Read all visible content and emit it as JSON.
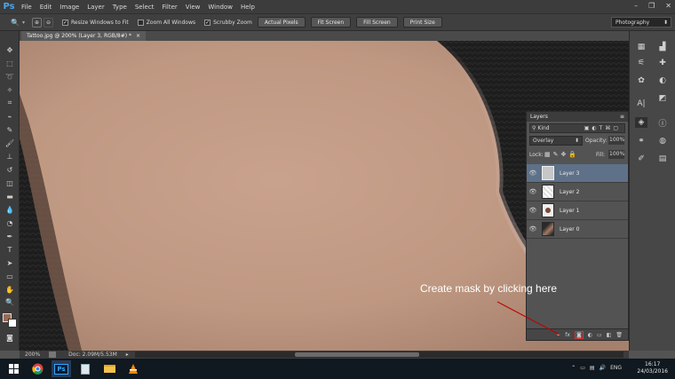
{
  "app": {
    "logo": "Ps"
  },
  "menu": [
    "File",
    "Edit",
    "Image",
    "Layer",
    "Type",
    "Select",
    "Filter",
    "View",
    "Window",
    "Help"
  ],
  "window_controls": [
    "–",
    "❐",
    "✕"
  ],
  "options": {
    "zoom_tool_icon": "🔍",
    "checks": [
      {
        "label": "Resize Windows to Fit",
        "checked": true
      },
      {
        "label": "Zoom All Windows",
        "checked": false
      },
      {
        "label": "Scrubby Zoom",
        "checked": true
      }
    ],
    "buttons": [
      "Actual Pixels",
      "Fit Screen",
      "Fill Screen",
      "Print Size"
    ],
    "workspace": "Photography"
  },
  "document_tab": "Tattoo.jpg @ 200% (Layer 3, RGB/8#) *",
  "layers_panel": {
    "title": "Layers",
    "filter_label": "Kind",
    "blend_mode": "Overlay",
    "opacity_label": "Opacity:",
    "opacity_value": "100%",
    "lock_label": "Lock:",
    "fill_label": "Fill:",
    "fill_value": "100%",
    "layers": [
      {
        "name": "Layer 3",
        "selected": true
      },
      {
        "name": "Layer 2",
        "selected": false
      },
      {
        "name": "Layer 1",
        "selected": false
      },
      {
        "name": "Layer 0",
        "selected": false
      }
    ],
    "footer_icons": [
      "⚭",
      "fx",
      "◙",
      "◐",
      "▭",
      "◧",
      "🗑"
    ]
  },
  "annotation": "Create mask by clicking here",
  "status": {
    "zoom": "200%",
    "doc": "Doc: 2.09M/5.53M"
  },
  "taskbar": {
    "lang": "ENG",
    "time": "16:17",
    "date": "24/03/2016"
  }
}
